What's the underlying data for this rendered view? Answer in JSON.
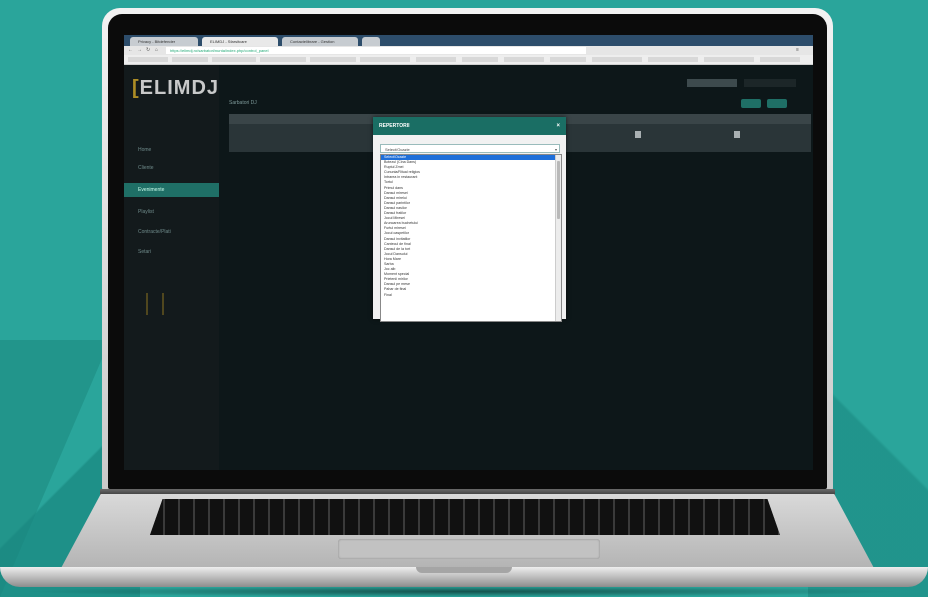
{
  "browser": {
    "tabs": [
      {
        "label": "Privacy - Bitdefender"
      },
      {
        "label": "ELIMDJ - Sfarsitcare"
      },
      {
        "label": "Contactelibrare - Gestion"
      },
      {
        "label": ""
      }
    ],
    "url": "https://elimdj.ro/sarbatori/nunta/index.php/control_panel"
  },
  "app": {
    "logo": "ELIMDJ",
    "page_title": "Sarbatori DJ",
    "nav": [
      {
        "label": "Home"
      },
      {
        "label": "Cliente"
      },
      {
        "label": "Evenimente"
      },
      {
        "label": "Playlist"
      },
      {
        "label": "Contracte/Plati"
      },
      {
        "label": "Setari"
      }
    ]
  },
  "modal": {
    "title": "REPERTORII",
    "close": "×",
    "select_value": "Select/Ocazie",
    "options": [
      "Select/Ocazie",
      "Botezul (Cina Dans)",
      "Ruptul Zmei",
      "Cununia/Ritual religios",
      "Intrarea in restaurant",
      "Tortul",
      "Primul dans",
      "Dansul miresei",
      "Dansul mirelui",
      "Dansul parintilor",
      "Dansul nasilor",
      "Dansul fratilor",
      "Jocul Miresei",
      "Aruncarea buchetului",
      "Furtul miresei",
      "Jocul oaspetilor",
      "Dansul invitatilor",
      "Cantecul de final",
      "Dansul de la tort",
      "Jocul Dansului",
      "Hora Mare",
      "Sarba",
      "Joc alb",
      "Moment special",
      "Prietenii mirilor",
      "Dansul pe mese",
      "Pahar de final",
      "Final"
    ]
  },
  "colors": {
    "background": "#2aa59b",
    "accent": "#1a6e64",
    "selection": "#1e6fd9"
  }
}
